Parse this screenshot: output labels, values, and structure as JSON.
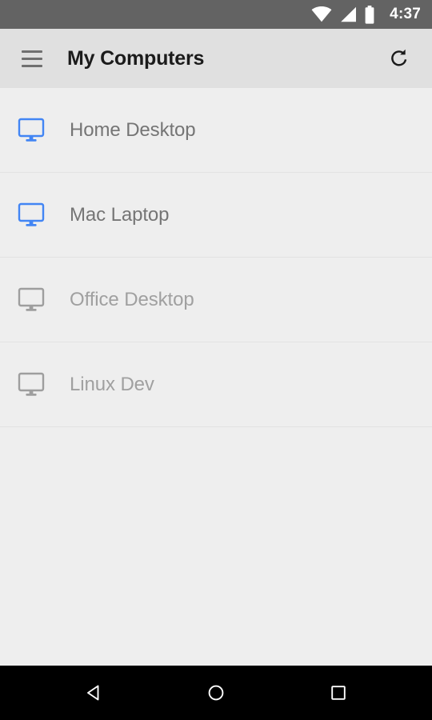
{
  "status_bar": {
    "time": "4:37",
    "icons": [
      "wifi-icon",
      "cellular-signal-icon",
      "battery-icon"
    ],
    "background_color": "#636363"
  },
  "app_bar": {
    "menu_icon": "hamburger-menu-icon",
    "title": "My Computers",
    "refresh_icon": "refresh-icon",
    "background_color": "#e0e0e0",
    "title_color": "#1b1b1b"
  },
  "colors": {
    "online_icon": "#4285F4",
    "offline_icon": "#9e9e9e",
    "online_text": "#757575",
    "offline_text": "#a0a0a0",
    "list_background": "#eeeeee",
    "divider": "#e2e2e2"
  },
  "computers": [
    {
      "name": "Home Desktop",
      "status": "online",
      "icon": "monitor-icon"
    },
    {
      "name": "Mac Laptop",
      "status": "online",
      "icon": "monitor-icon"
    },
    {
      "name": "Office Desktop",
      "status": "offline",
      "icon": "monitor-icon"
    },
    {
      "name": "Linux Dev",
      "status": "offline",
      "icon": "monitor-icon"
    }
  ],
  "nav_bar": {
    "back_label": "Back",
    "home_label": "Home",
    "recents_label": "Recents",
    "background_color": "#000000"
  }
}
